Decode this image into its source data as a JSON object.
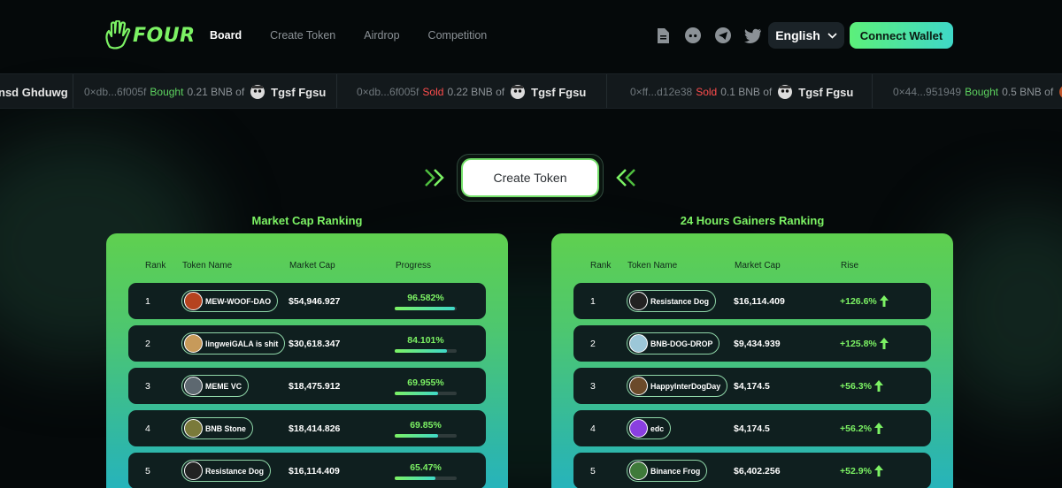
{
  "brand": {
    "name": "FOUR"
  },
  "nav": [
    {
      "label": "Board",
      "active": true
    },
    {
      "label": "Create Token",
      "active": false
    },
    {
      "label": "Airdrop",
      "active": false
    },
    {
      "label": "Competition",
      "active": false
    }
  ],
  "socials": [
    "document-icon",
    "discord-icon",
    "telegram-icon",
    "twitter-icon"
  ],
  "language": {
    "label": "English"
  },
  "connect_wallet": {
    "label": "Connect Wallet"
  },
  "ticker": {
    "lead": "nsd Ghduwg",
    "items": [
      {
        "addr": "0×db...6f005f",
        "action": "Bought",
        "amount": "0.21 BNB of",
        "token": "Tgsf Fgsu"
      },
      {
        "addr": "0×db...6f005f",
        "action": "Sold",
        "amount": "0.22 BNB of",
        "token": "Tgsf Fgsu"
      },
      {
        "addr": "0×ff...d12e38",
        "action": "Sold",
        "amount": "0.1 BNB of",
        "token": "Tgsf Fgsu"
      },
      {
        "addr": "0×44...951949",
        "action": "Bought",
        "amount": "0.5 BNB of",
        "token": ""
      }
    ]
  },
  "create_token": {
    "label": "Create Token"
  },
  "market_cap_ranking": {
    "title": "Market Cap Ranking",
    "columns": [
      "Rank",
      "Token Name",
      "Market Cap",
      "Progress"
    ],
    "rows": [
      {
        "rank": "1",
        "token": "MEW-WOOF-DAO",
        "mcap": "$54,946.927",
        "progress": "96.582%",
        "progress_value": 96.582,
        "avatar_color": "#b5431f"
      },
      {
        "rank": "2",
        "token": "lingweiGALA is shit",
        "mcap": "$30,618.347",
        "progress": "84.101%",
        "progress_value": 84.101,
        "avatar_color": "#c79a5a"
      },
      {
        "rank": "3",
        "token": "MEME VC",
        "mcap": "$18,475.912",
        "progress": "69.955%",
        "progress_value": 69.955,
        "avatar_color": "#5d6870"
      },
      {
        "rank": "4",
        "token": "BNB Stone",
        "mcap": "$18,414.826",
        "progress": "69.85%",
        "progress_value": 69.85,
        "avatar_color": "#7a7a3a"
      },
      {
        "rank": "5",
        "token": "Resistance Dog",
        "mcap": "$16,114.409",
        "progress": "65.47%",
        "progress_value": 65.47,
        "avatar_color": "#222222"
      }
    ]
  },
  "gainers_ranking": {
    "title": "24 Hours Gainers Ranking",
    "columns": [
      "Rank",
      "Token Name",
      "Market Cap",
      "Rise"
    ],
    "rows": [
      {
        "rank": "1",
        "token": "Resistance Dog",
        "mcap": "$16,114.409",
        "rise": "+126.6%",
        "avatar_color": "#222222"
      },
      {
        "rank": "2",
        "token": "BNB-DOG-DROP",
        "mcap": "$9,434.939",
        "rise": "+125.8%",
        "avatar_color": "#9cc7d8"
      },
      {
        "rank": "3",
        "token": "HappyInterDogDay",
        "mcap": "$4,174.5",
        "rise": "+56.3%",
        "avatar_color": "#6b4a2a"
      },
      {
        "rank": "4",
        "token": "edc",
        "mcap": "$4,174.5",
        "rise": "+56.2%",
        "avatar_color": "#8a3fe0"
      },
      {
        "rank": "5",
        "token": "Binance Frog",
        "mcap": "$6,402.256",
        "rise": "+52.9%",
        "avatar_color": "#3f7a3a"
      }
    ]
  },
  "colors": {
    "accent": "#7cf264",
    "buy": "#5dd35f",
    "sell": "#ff4d4d",
    "bg": "#05090a"
  }
}
